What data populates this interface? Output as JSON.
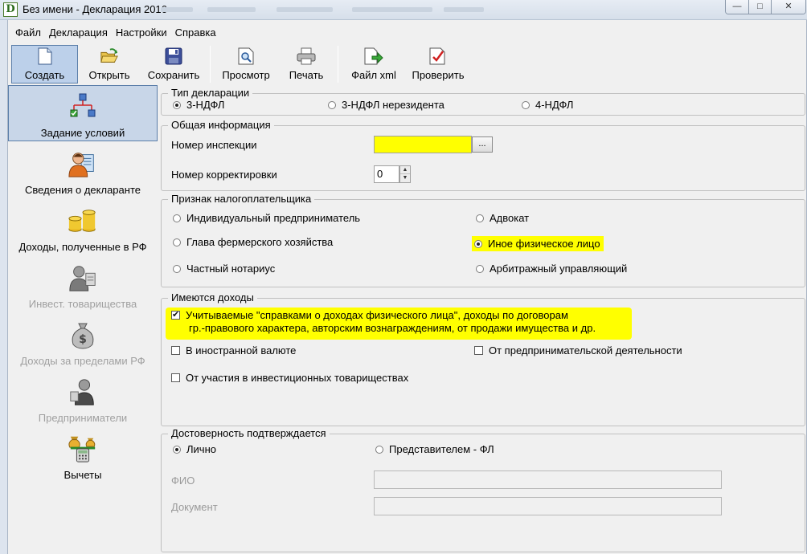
{
  "window": {
    "title": "Без имени - Декларация 2016",
    "app_icon_letter": "D",
    "minimize_glyph": "—",
    "maximize_glyph": "□",
    "close_glyph": "✕"
  },
  "menu": [
    "Файл",
    "Декларация",
    "Настройки",
    "Справка"
  ],
  "toolbar": {
    "create": "Создать",
    "open": "Открыть",
    "save": "Сохранить",
    "preview": "Просмотр",
    "print": "Печать",
    "xml": "Файл xml",
    "check": "Проверить"
  },
  "sidebar": {
    "items": [
      {
        "label": "Задание условий",
        "icon": "conditions-icon",
        "active": true
      },
      {
        "label": "Сведения о декларанте",
        "icon": "declarant-icon"
      },
      {
        "label": "Доходы, полученные в РФ",
        "icon": "coins-icon"
      },
      {
        "label": "Инвест. товарищества",
        "icon": "partnership-icon",
        "disabled": true
      },
      {
        "label": "Доходы за пределами РФ",
        "icon": "money-bag-icon",
        "disabled": true
      },
      {
        "label": "Предприниматели",
        "icon": "entrepreneur-icon",
        "disabled": true
      },
      {
        "label": "Вычеты",
        "icon": "deductions-icon"
      }
    ]
  },
  "declaration_type": {
    "title": "Тип декларации",
    "options": [
      "3-НДФЛ",
      "3-НДФЛ нерезидента",
      "4-НДФЛ"
    ],
    "selected": "3-НДФЛ"
  },
  "general_info": {
    "title": "Общая информация",
    "inspection_label": "Номер инспекции",
    "inspection_value": "",
    "browse_button": "...",
    "correction_label": "Номер корректировки",
    "correction_value": "0",
    "highlight_color": "#ffff00"
  },
  "taxpayer": {
    "title": "Признак налогоплательщика",
    "options": [
      "Индивидуальный предприниматель",
      "Адвокат",
      "Глава фермерского хозяйства",
      "Иное физическое лицо",
      "Частный нотариус",
      "Арбитражный управляющий"
    ],
    "selected": "Иное физическое лицо"
  },
  "incomes": {
    "title": "Имеются доходы",
    "main_line1": "Учитываемые \"справками о доходах физического лица\", доходы по договорам",
    "main_line2": "гр.-правового характера, авторским вознаграждениям, от продажи имущества и др.",
    "main_checked": true,
    "foreign_currency": "В иностранной валюте",
    "business": "От предпринимательской деятельности",
    "partnerships": "От участия в инвестиционных товариществах"
  },
  "confirmation": {
    "title": "Достоверность подтверждается",
    "personal": "Лично",
    "representative": "Представителем - ФЛ",
    "selected": "Лично",
    "fio_label": "ФИО",
    "document_label": "Документ"
  }
}
